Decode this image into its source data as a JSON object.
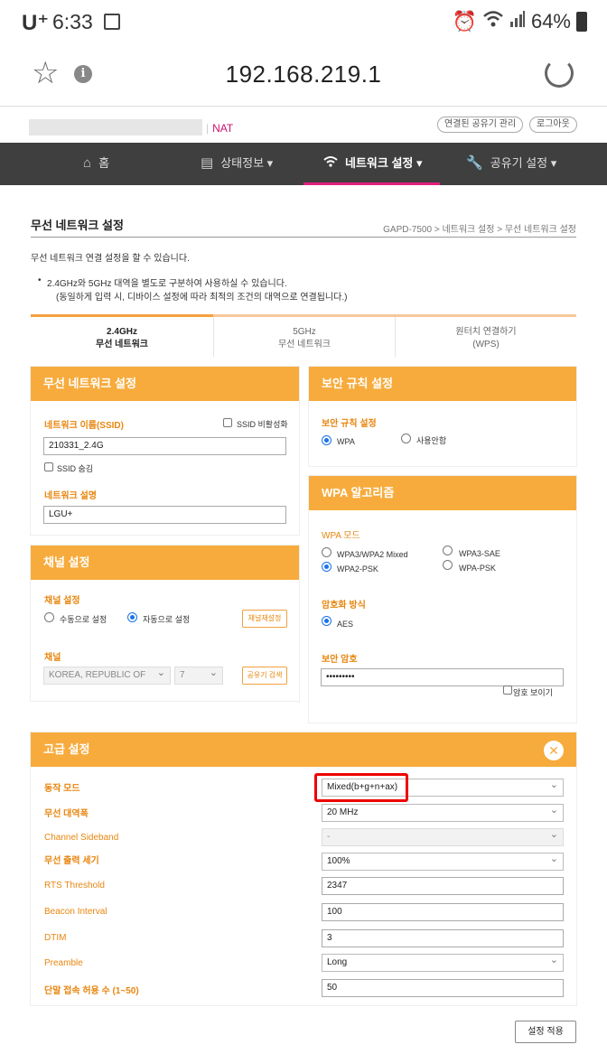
{
  "statusbar": {
    "carrier": "U⁺",
    "time": "6:33",
    "battery": "64%"
  },
  "urlbar": {
    "url": "192.168.219.1"
  },
  "header": {
    "nat": "NAT",
    "btn_manage": "연결된 공유기 관리",
    "btn_logout": "로그아웃"
  },
  "nav": {
    "home": "홈",
    "status": "상태정보 ▾",
    "network": "네트워크 설정 ▾",
    "router": "공유기 설정 ▾"
  },
  "page": {
    "title": "무선 네트워크 설정",
    "breadcrumb": "GAPD-7500 > 네트워크 설정 > 무선 네트워크 설정",
    "desc": "무선 네트워크 연결 설정을 할 수 있습니다.",
    "bullet1": "2.4GHz와 5GHz 대역을 별도로 구분하여 사용하실 수 있습니다.",
    "bullet2": "(동일하게 입력 시, 디바이스 설정에 따라 최적의 조건의 대역으로 연결됩니다.)"
  },
  "tabs": [
    {
      "line1": "2.4GHz",
      "line2": "무선 네트워크"
    },
    {
      "line1": "5GHz",
      "line2": "무선 네트워크"
    },
    {
      "line1": "원터치 연결하기",
      "line2": "(WPS)"
    }
  ],
  "wireless": {
    "header": "무선 네트워크 설정",
    "ssid_label": "네트워크 이름(SSID)",
    "ssid_disable": "SSID 비활성화",
    "ssid_value": "210331_2.4G",
    "ssid_hide": "SSID 숨김",
    "desc_label": "네트워크 설명",
    "desc_value": "LGU+"
  },
  "channel": {
    "header": "채널 설정",
    "setting_label": "채널 설정",
    "manual": "수동으로 설정",
    "auto": "자동으로 설정",
    "reset_btn": "채널재설정",
    "channel_label": "채널",
    "country": "KOREA, REPUBLIC OF",
    "channel_value": "7",
    "search_btn": "공유기 검색"
  },
  "security": {
    "header": "보안 규칙 설정",
    "label": "보안 규칙 설정",
    "wpa": "WPA",
    "none": "사용안함"
  },
  "wpa": {
    "header": "WPA 알고리즘",
    "mode_label": "WPA 모드",
    "mode1": "WPA3/WPA2 Mixed",
    "mode2": "WPA3-SAE",
    "mode3": "WPA2-PSK",
    "mode4": "WPA-PSK",
    "enc_label": "암호화 방식",
    "enc_aes": "AES",
    "pw_label": "보안 암호",
    "pw_value": "•••••••••",
    "show_pw": "암호 보이기"
  },
  "advanced": {
    "header": "고급 설정",
    "close": "✕",
    "rows": [
      {
        "label": "동작 모드",
        "value": "Mixed(b+g+n+ax)"
      },
      {
        "label": "무선 대역폭",
        "value": "20 MHz"
      },
      {
        "label": "Channel Sideband",
        "value": "-"
      },
      {
        "label": "무선 출력 세기",
        "value": "100%"
      },
      {
        "label": "RTS Threshold",
        "value": "2347"
      },
      {
        "label": "Beacon Interval",
        "value": "100"
      },
      {
        "label": "DTIM",
        "value": "3"
      },
      {
        "label": "Preamble",
        "value": "Long"
      },
      {
        "label": "단말 접속 허용 수 (1~50)",
        "value": "50"
      }
    ]
  },
  "apply": "설정 적용",
  "colors": {
    "accent": "#f7ab3c",
    "nav_bg": "#3f3f3f",
    "nav_active": "#e0207f",
    "highlight": "#ee0000"
  }
}
